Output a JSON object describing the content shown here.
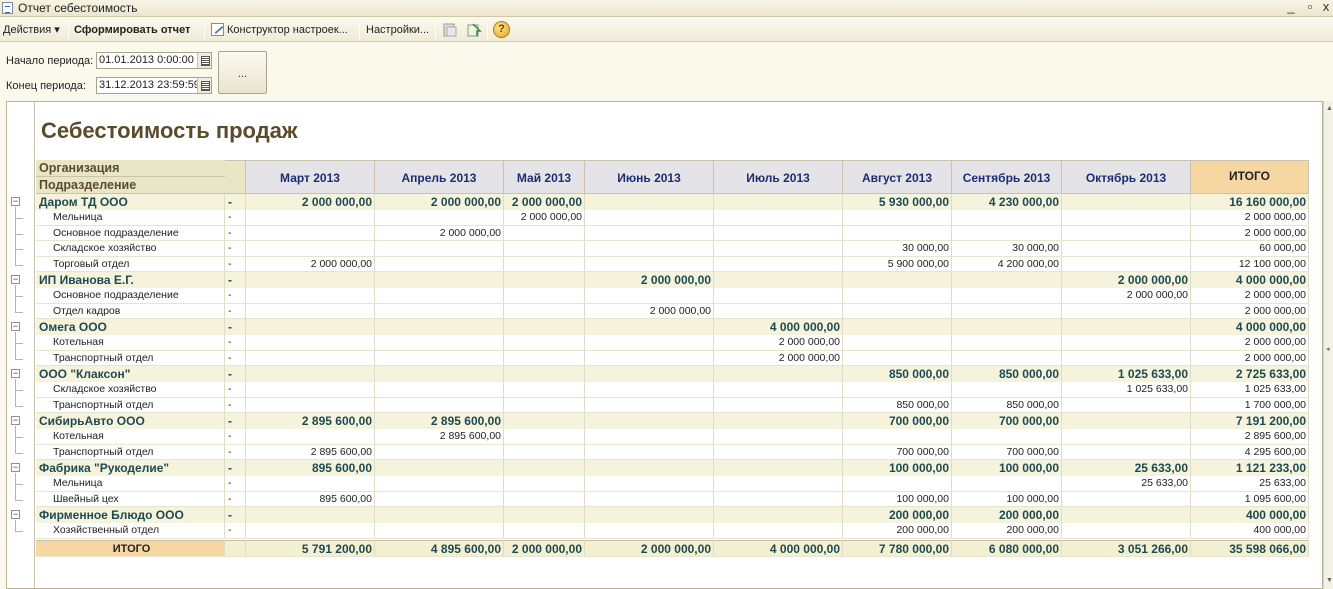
{
  "window": {
    "title": "Отчет себестоимость",
    "min_glyph": "_",
    "restore_glyph": "▫",
    "close_glyph": "x"
  },
  "toolbar": {
    "actions_label": "Действия",
    "dropdown_glyph": "▾",
    "generate_label": "Сформировать отчет",
    "constructor_label": "Конструктор настроек...",
    "settings_label": "Настройки...",
    "help_glyph": "?"
  },
  "params": {
    "start_label": "Начало периода:",
    "start_value": "01.01.2013  0:00:00",
    "end_label": "Конец периода:",
    "end_value": "31.12.2013 23:59:59",
    "dots_label": "..."
  },
  "report": {
    "title": "Себестоимость продаж",
    "row_header_org": "Организация",
    "row_header_dept": "Подразделение",
    "columns": [
      "Март 2013",
      "Апрель 2013",
      "Май 2013",
      "Июнь 2013",
      "Июль 2013",
      "Август 2013",
      "Сентябрь 2013",
      "Октябрь 2013",
      "ИТОГО"
    ],
    "groups": [
      {
        "name": "Даром ТД ООО",
        "dash": "-",
        "values": [
          "2 000 000,00",
          "2 000 000,00",
          "2 000 000,00",
          "",
          "",
          "5 930 000,00",
          "4 230 000,00",
          "",
          "16 160 000,00"
        ],
        "children": [
          {
            "name": "Мельница",
            "dash": "-",
            "values": [
              "",
              "",
              "2 000 000,00",
              "",
              "",
              "",
              "",
              "",
              "2 000 000,00"
            ]
          },
          {
            "name": "Основное подразделение",
            "dash": "-",
            "values": [
              "",
              "2 000 000,00",
              "",
              "",
              "",
              "",
              "",
              "",
              "2 000 000,00"
            ]
          },
          {
            "name": "Складское хозяйство",
            "dash": "-",
            "values": [
              "",
              "",
              "",
              "",
              "",
              "30 000,00",
              "30 000,00",
              "",
              "60 000,00"
            ]
          },
          {
            "name": "Торговый отдел",
            "dash": "-",
            "values": [
              "2 000 000,00",
              "",
              "",
              "",
              "",
              "5 900 000,00",
              "4 200 000,00",
              "",
              "12 100 000,00"
            ]
          }
        ]
      },
      {
        "name": "ИП Иванова Е.Г.",
        "dash": "-",
        "values": [
          "",
          "",
          "",
          "2 000 000,00",
          "",
          "",
          "",
          "2 000 000,00",
          "4 000 000,00"
        ],
        "children": [
          {
            "name": "Основное подразделение",
            "dash": "-",
            "values": [
              "",
              "",
              "",
              "",
              "",
              "",
              "",
              "2 000 000,00",
              "2 000 000,00"
            ]
          },
          {
            "name": "Отдел кадров",
            "dash": "-",
            "values": [
              "",
              "",
              "",
              "2 000 000,00",
              "",
              "",
              "",
              "",
              "2 000 000,00"
            ]
          }
        ]
      },
      {
        "name": "Омега ООО",
        "dash": "-",
        "values": [
          "",
          "",
          "",
          "",
          "4 000 000,00",
          "",
          "",
          "",
          "4 000 000,00"
        ],
        "children": [
          {
            "name": "Котельная",
            "dash": "-",
            "values": [
              "",
              "",
              "",
              "",
              "2 000 000,00",
              "",
              "",
              "",
              "2 000 000,00"
            ]
          },
          {
            "name": "Транспортный отдел",
            "dash": "-",
            "values": [
              "",
              "",
              "",
              "",
              "2 000 000,00",
              "",
              "",
              "",
              "2 000 000,00"
            ]
          }
        ]
      },
      {
        "name": "ООО \"Клаксон\"",
        "dash": "-",
        "values": [
          "",
          "",
          "",
          "",
          "",
          "850 000,00",
          "850 000,00",
          "1 025 633,00",
          "2 725 633,00"
        ],
        "children": [
          {
            "name": "Складское хозяйство",
            "dash": "-",
            "values": [
              "",
              "",
              "",
              "",
              "",
              "",
              "",
              "1 025 633,00",
              "1 025 633,00"
            ]
          },
          {
            "name": "Транспортный отдел",
            "dash": "-",
            "values": [
              "",
              "",
              "",
              "",
              "",
              "850 000,00",
              "850 000,00",
              "",
              "1 700 000,00"
            ]
          }
        ]
      },
      {
        "name": "СибирьАвто ООО",
        "dash": "-",
        "values": [
          "2 895 600,00",
          "2 895 600,00",
          "",
          "",
          "",
          "700 000,00",
          "700 000,00",
          "",
          "7 191 200,00"
        ],
        "children": [
          {
            "name": "Котельная",
            "dash": "-",
            "values": [
              "",
              "2 895 600,00",
              "",
              "",
              "",
              "",
              "",
              "",
              "2 895 600,00"
            ]
          },
          {
            "name": "Транспортный отдел",
            "dash": "-",
            "values": [
              "2 895 600,00",
              "",
              "",
              "",
              "",
              "700 000,00",
              "700 000,00",
              "",
              "4 295 600,00"
            ]
          }
        ]
      },
      {
        "name": "Фабрика \"Рукоделие\"",
        "dash": "-",
        "values": [
          "895 600,00",
          "",
          "",
          "",
          "",
          "100 000,00",
          "100 000,00",
          "25 633,00",
          "1 121 233,00"
        ],
        "children": [
          {
            "name": "Мельница",
            "dash": "-",
            "values": [
              "",
              "",
              "",
              "",
              "",
              "",
              "",
              "25 633,00",
              "25 633,00"
            ]
          },
          {
            "name": "Швейный цех",
            "dash": "-",
            "values": [
              "895 600,00",
              "",
              "",
              "",
              "",
              "100 000,00",
              "100 000,00",
              "",
              "1 095 600,00"
            ]
          }
        ]
      },
      {
        "name": "Фирменное Блюдо ООО",
        "dash": "-",
        "values": [
          "",
          "",
          "",
          "",
          "",
          "200 000,00",
          "200 000,00",
          "",
          "400 000,00"
        ],
        "children": [
          {
            "name": "Хозяйственный отдел",
            "dash": "-",
            "values": [
              "",
              "",
              "",
              "",
              "",
              "200 000,00",
              "200 000,00",
              "",
              "400 000,00"
            ]
          }
        ]
      }
    ],
    "total": {
      "label": "ИТОГО",
      "values": [
        "5 791 200,00",
        "4 895 600,00",
        "2 000 000,00",
        "2 000 000,00",
        "4 000 000,00",
        "7 780 000,00",
        "6 080 000,00",
        "3 051 266,00",
        "35 598 066,00"
      ]
    }
  }
}
